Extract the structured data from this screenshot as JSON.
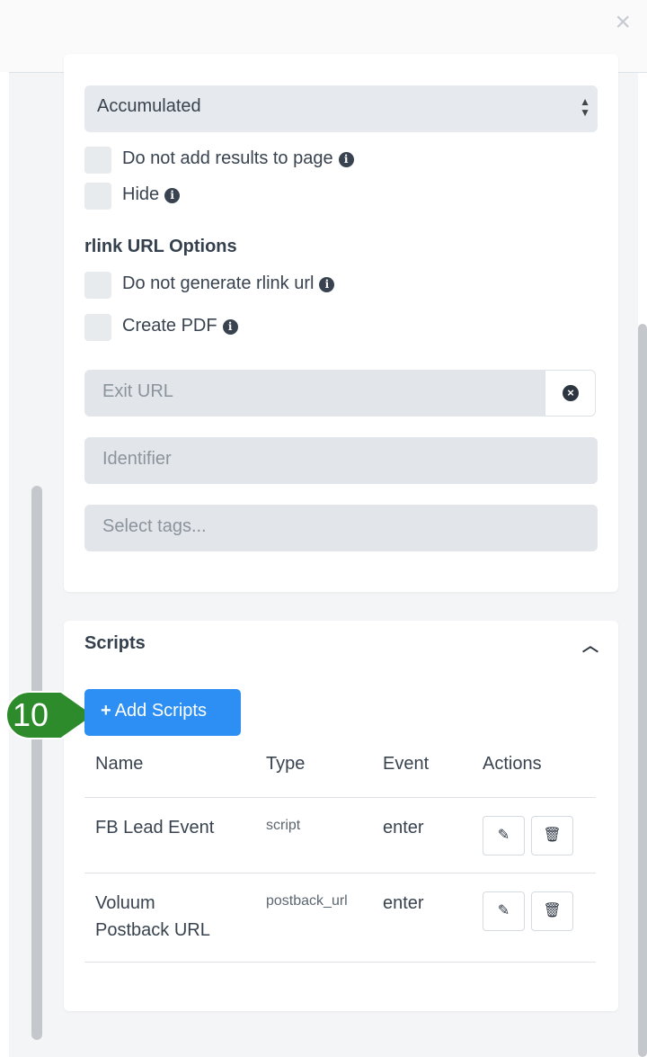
{
  "modal": {
    "close_label": "×"
  },
  "settings": {
    "select_value": "Accumulated",
    "checks": [
      {
        "label": "Do not add results to page"
      },
      {
        "label": "Hide"
      }
    ],
    "rlink_title": "rlink URL Options",
    "rlink_checks": [
      {
        "label": "Do not generate rlink url"
      },
      {
        "label": "Create PDF"
      }
    ],
    "exit_url_placeholder": "Exit URL",
    "identifier_placeholder": "Identifier",
    "tags_placeholder": "Select tags..."
  },
  "scripts": {
    "title": "Scripts",
    "add_button": "Add Scripts",
    "step_number": "10",
    "columns": [
      "Name",
      "Type",
      "Event",
      "Actions"
    ],
    "rows": [
      {
        "name_line1": "FB Lead Event",
        "name_line2": "",
        "type": "script",
        "event": "enter"
      },
      {
        "name_line1": "Voluum",
        "name_line2": "Postback URL",
        "type": "postback_url",
        "event": "enter"
      }
    ]
  },
  "colors": {
    "accent": "#2d8ff3",
    "step_badge": "#2e8b2b"
  }
}
